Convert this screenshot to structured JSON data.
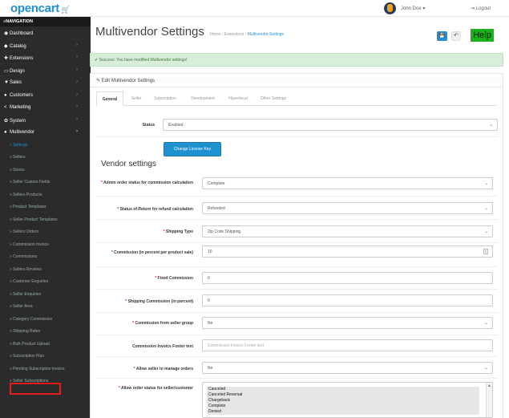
{
  "header": {
    "logo": "opencart",
    "user": "John Doe ▾",
    "logout": "Logout"
  },
  "sidebar": {
    "title": "NAVIGATION",
    "items": [
      {
        "label": "Dashboard",
        "icon": "dashboard-icon",
        "glyph": "◉",
        "chevron": ""
      },
      {
        "label": "Catalog",
        "icon": "tag-icon",
        "glyph": "◆",
        "chevron": "›"
      },
      {
        "label": "Extensions",
        "icon": "puzzle-icon",
        "glyph": "✚",
        "chevron": "›"
      },
      {
        "label": "Design",
        "icon": "monitor-icon",
        "glyph": "▭",
        "chevron": "›"
      },
      {
        "label": "Sales",
        "icon": "cart-icon",
        "glyph": "▼",
        "chevron": "›"
      },
      {
        "label": "Customers",
        "icon": "user-icon",
        "glyph": "●",
        "chevron": "›"
      },
      {
        "label": "Marketing",
        "icon": "share-icon",
        "glyph": "<",
        "chevron": "›"
      },
      {
        "label": "System",
        "icon": "gear-icon",
        "glyph": "✿",
        "chevron": "›"
      },
      {
        "label": "Multivendor",
        "icon": "user-icon",
        "glyph": "●",
        "chevron": "›"
      }
    ],
    "subitems": [
      "» Settings",
      "» Sellers",
      "» Stores",
      "» Seller Custom Fields",
      "» Sellers Products",
      "» Product Templates",
      "» Seller Product Templates",
      "» Sellers Orders",
      "» Commission Invoice",
      "» Commissions",
      "» Sellers Reviews",
      "» Customer Enquiries",
      "» Seller Enquiries",
      "» Seller Area",
      "» Category Commission",
      "» Shipping Rates",
      "» Bulk Product Upload",
      "» Subscription Plan",
      "» Pending Subscription Invoice",
      "» Seller Subscriptions"
    ]
  },
  "page": {
    "title": "Multivendor Settings",
    "breadcrumb": [
      "Home",
      "Extensions",
      "Multivendor Settings"
    ],
    "save_icon": "💾",
    "back_icon": "↶",
    "help": "Help"
  },
  "alert": "✔ Success: You have modified Multivendor settings!",
  "panel": {
    "heading": "✎ Edit Multivendor Settings",
    "tabs": [
      "General",
      "Seller",
      "Subscription",
      "Development",
      "Hyperlocal",
      "Other Settings"
    ]
  },
  "form": {
    "status_label": "Status",
    "status_value": "Enabled",
    "license_button": "Change License Key",
    "vendor_heading": "Vendor settings",
    "admin_order_status_label": "Admin order status for commission calculation",
    "admin_order_status_value": "Complete",
    "return_status_label": "Status of Return for refund calculation",
    "return_status_value": "Refunded",
    "shipping_type_label": "Shipping Type",
    "shipping_type_value": "Zip Code Shipping",
    "commission_percent_label": "Commission (in percent per product sale)",
    "commission_percent_value": "10",
    "fixed_commission_label": "Fixed Commission",
    "fixed_commission_value": "0",
    "shipping_commission_label": "Shipping Commission (in percent)",
    "shipping_commission_value": "0",
    "commission_seller_group_label": "Commission from seller group",
    "commission_seller_group_value": "No",
    "invoice_footer_label": "Commission Invoice Footer text",
    "invoice_footer_placeholder": "Commission Invoice Footer text",
    "allow_manage_orders_label": "Allow seller to manage orders",
    "allow_manage_orders_value": "No",
    "allow_order_status_label": "Allow order status for seller/customer",
    "order_status_options": [
      "Canceled",
      "Canceled Reversal",
      "Chargeback",
      "Complete",
      "Denied"
    ]
  }
}
